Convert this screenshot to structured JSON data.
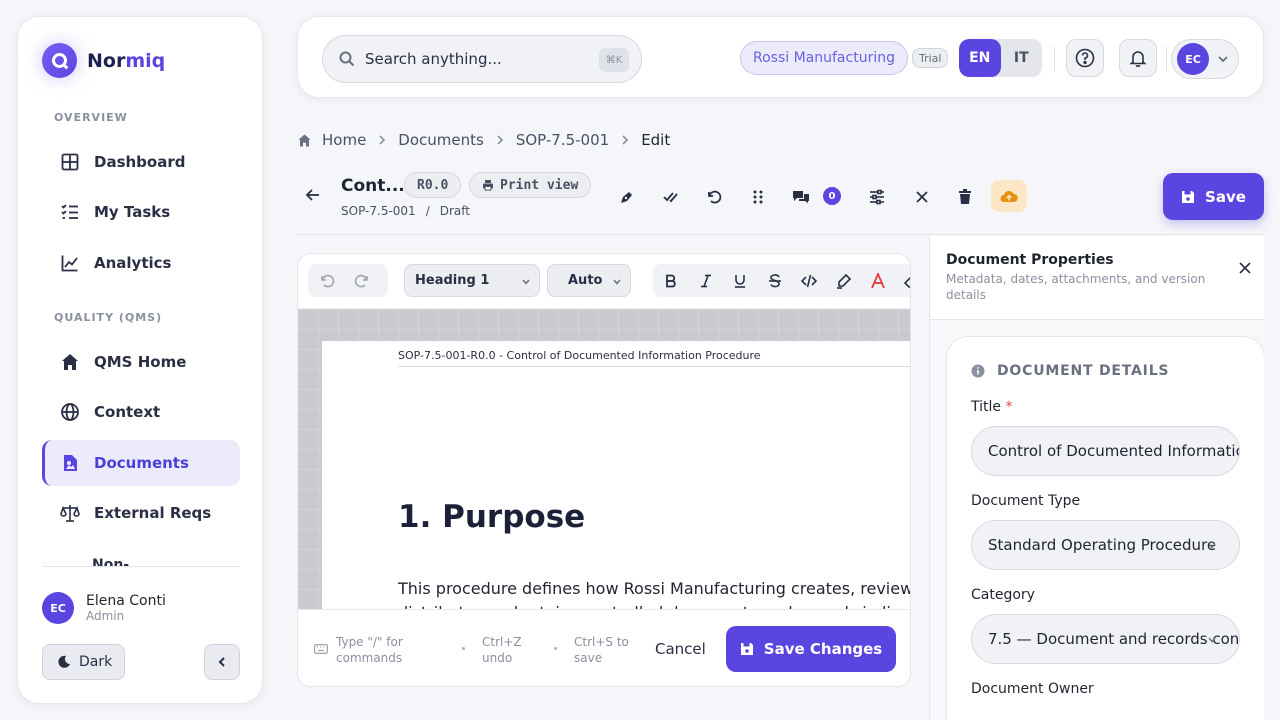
{
  "brand": {
    "name_a": "Nor",
    "name_b": "miq"
  },
  "sidebar": {
    "overview_label": "OVERVIEW",
    "qms_label": "QUALITY (QMS)",
    "items": [
      {
        "label": "Dashboard",
        "icon": "grid-icon"
      },
      {
        "label": "My Tasks",
        "icon": "checklist-icon"
      },
      {
        "label": "Analytics",
        "icon": "chart-line-icon"
      },
      {
        "label": "QMS Home",
        "icon": "home-icon"
      },
      {
        "label": "Context",
        "icon": "globe-icon"
      },
      {
        "label": "Documents",
        "icon": "document-icon",
        "active": true
      },
      {
        "label": "External Reqs",
        "icon": "scale-icon"
      },
      {
        "label": "Non-",
        "icon": ""
      }
    ],
    "user": {
      "initials": "EC",
      "name": "Elena Conti",
      "role": "Admin"
    },
    "dark_label": "Dark"
  },
  "topbar": {
    "search_placeholder": "Search anything...",
    "search_shortcut": "⌘K",
    "company": "Rossi Manufacturing",
    "plan": "Trial",
    "lang": [
      "EN",
      "IT"
    ],
    "avatar_initials": "EC"
  },
  "breadcrumb": [
    "Home",
    "Documents",
    "SOP-7.5-001",
    "Edit"
  ],
  "doc": {
    "title": "Cont...",
    "revision": "R0.0",
    "print_label": "Print view",
    "code": "SOP-7.5-001",
    "sep": "/",
    "status": "Draft",
    "comment_count": "0",
    "save_label": "Save"
  },
  "editor": {
    "style_select": "Heading 1",
    "size_select": "Auto",
    "page_header": "SOP-7.5-001-R0.0 - Control of Documented Information Procedure",
    "heading": "1. Purpose",
    "paragraph": "This procedure defines how Rossi Manufacturing creates, reviews, ap",
    "paragraph2": "distributes and retains controlled documents and records in line with",
    "hint_cmd": "Type \"/\" for commands",
    "hint_undo": "Ctrl+Z undo",
    "hint_save": "Ctrl+S to save",
    "cancel_label": "Cancel",
    "save_changes_label": "Save Changes"
  },
  "properties": {
    "title": "Document Properties",
    "subtitle": "Metadata, dates, attachments, and version details",
    "section": "DOCUMENT DETAILS",
    "fields": [
      {
        "label": "Title",
        "value": "Control of Documented Information Procedure",
        "required": "*"
      },
      {
        "label": "Document Type",
        "value": "Standard Operating Procedure"
      },
      {
        "label": "Category",
        "value": "7.5 — Document and records control"
      },
      {
        "label": "Document Owner",
        "value": ""
      }
    ]
  },
  "colors": {
    "accent": "#5b45e0",
    "accent_soft": "#ecebfb",
    "warning_soft": "#fde6c5"
  }
}
